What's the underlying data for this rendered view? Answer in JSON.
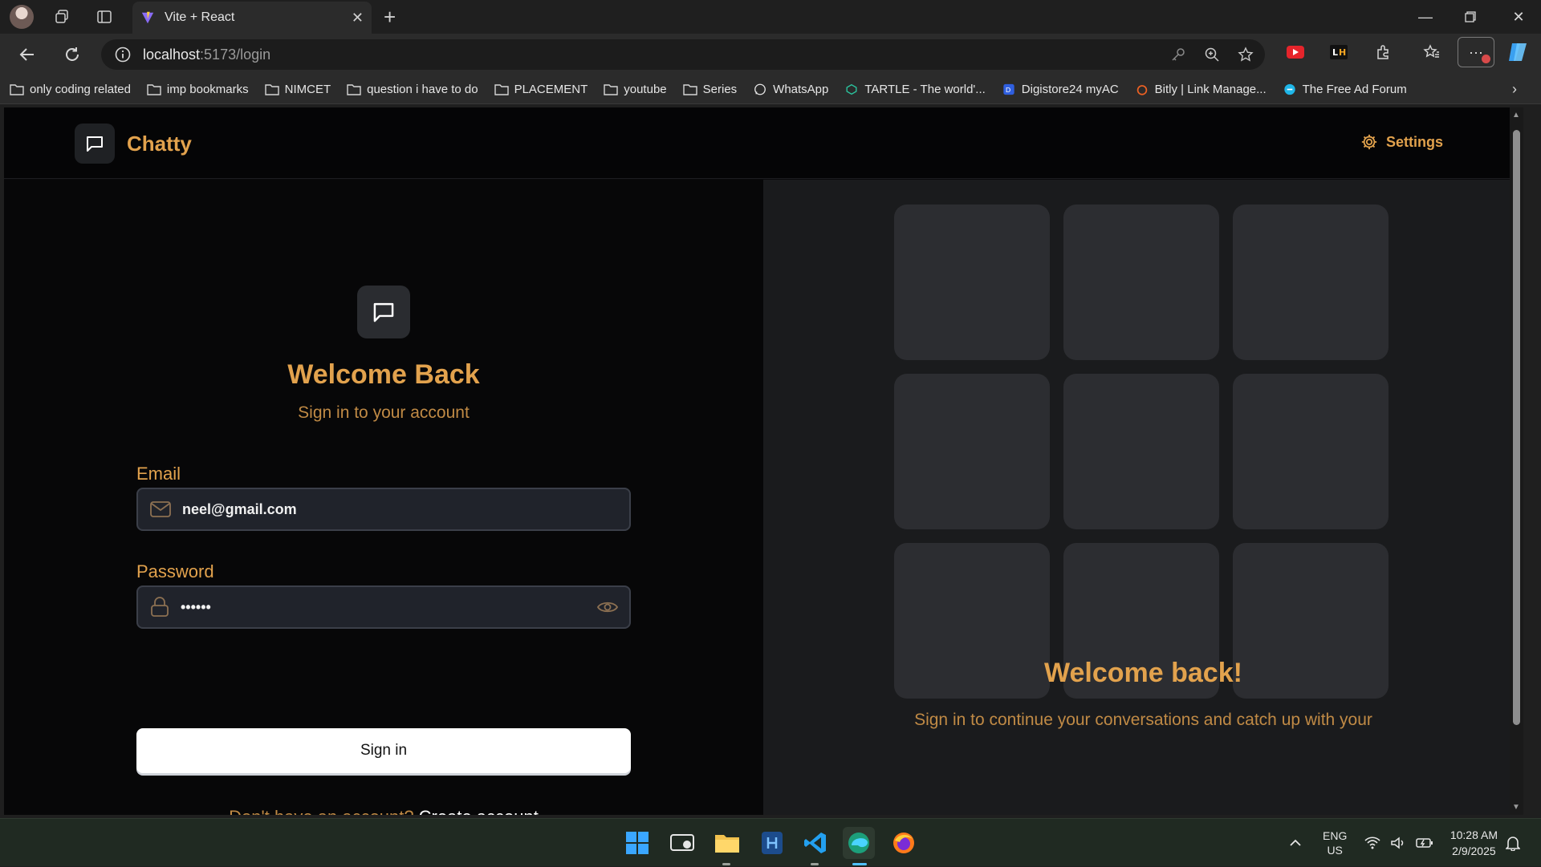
{
  "browser": {
    "tab_title": "Vite + React",
    "url_host": "localhost",
    "url_path": ":5173/login",
    "bookmarks": [
      "only coding  related",
      "imp bookmarks",
      "NIMCET",
      "question i have to do",
      "PLACEMENT",
      "youtube",
      "Series",
      "WhatsApp",
      "TARTLE - The world'...",
      "Digistore24 myAC",
      "Bitly | Link Manage...",
      "The Free Ad Forum"
    ]
  },
  "app": {
    "brand": "Chatty",
    "settings_label": "Settings"
  },
  "login": {
    "title": "Welcome Back",
    "subtitle": "Sign in to your account",
    "email_label": "Email",
    "email_value": "neel@gmail.com",
    "password_label": "Password",
    "password_value": "••••••",
    "signin_label": "Sign in",
    "signup_prompt": "Don't have an account?",
    "signup_link": "Create account"
  },
  "side_panel": {
    "title": "Welcome back!",
    "subtitle": "Sign in to continue your conversations and catch up with your"
  },
  "taskbar": {
    "lang_line1": "ENG",
    "lang_line2": "US",
    "time": "10:28 AM",
    "date": "2/9/2025"
  },
  "colors": {
    "accent": "#e2a24d",
    "page_bg": "#0a0a0b",
    "panel_bg": "#1a1b1d",
    "tile_bg": "#2c2d31"
  }
}
